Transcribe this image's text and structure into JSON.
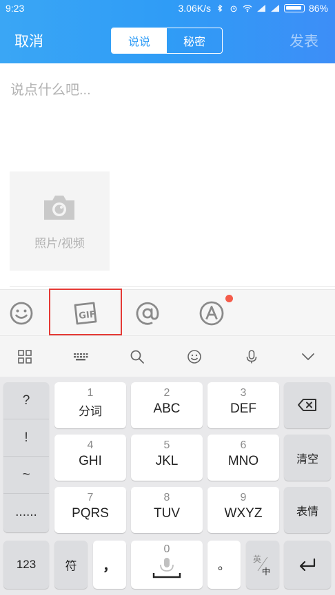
{
  "status": {
    "time": "9:23",
    "speed": "3.06K/s",
    "battery": "86%"
  },
  "header": {
    "cancel": "取消",
    "publish": "发表",
    "tabs": [
      {
        "label": "说说",
        "active": true
      },
      {
        "label": "秘密",
        "active": false
      }
    ]
  },
  "compose": {
    "placeholder": "说点什么吧...",
    "media_label": "照片/视频"
  },
  "toolbar": {
    "items": [
      "emoji-icon",
      "gif-icon",
      "at-icon",
      "font-style-icon"
    ],
    "highlight_color": "#e53935",
    "badge_color": "#f45b4a"
  },
  "ime_bar": {
    "items": [
      "grid-icon",
      "keyboard-icon",
      "search-icon",
      "emoji-icon",
      "mic-icon",
      "chevron-down-icon"
    ]
  },
  "keyboard": {
    "punct": [
      "?",
      "!",
      "~",
      "......"
    ],
    "keys": [
      {
        "num": "1",
        "label": "分词"
      },
      {
        "num": "2",
        "label": "ABC"
      },
      {
        "num": "3",
        "label": "DEF"
      },
      {
        "num": "4",
        "label": "GHI"
      },
      {
        "num": "5",
        "label": "JKL"
      },
      {
        "num": "6",
        "label": "MNO"
      },
      {
        "num": "7",
        "label": "PQRS"
      },
      {
        "num": "8",
        "label": "TUV"
      },
      {
        "num": "9",
        "label": "WXYZ"
      }
    ],
    "clear": "清空",
    "emoticon": "表情",
    "mode_123": "123",
    "symbol": "符",
    "comma": "，",
    "space_num": "0",
    "period": "。",
    "lang_en": "英",
    "lang_zh": "中"
  },
  "colors": {
    "accent": "#2f9cf6"
  }
}
